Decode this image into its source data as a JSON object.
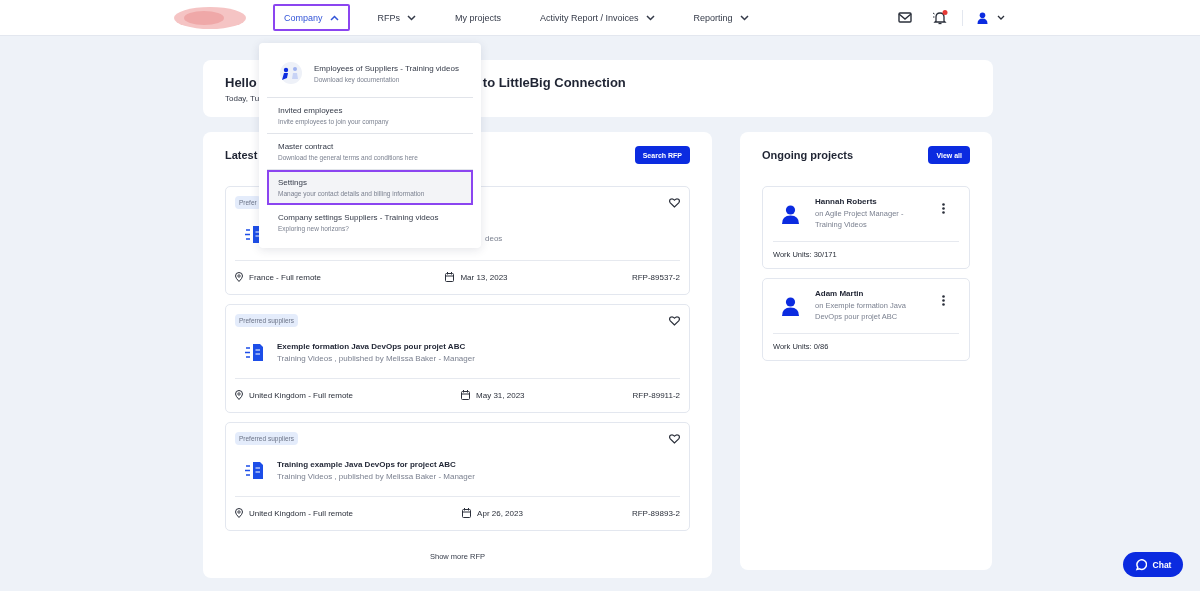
{
  "nav": {
    "items": [
      {
        "label": "Company",
        "has_caret": true,
        "expanded": true,
        "selected": true
      },
      {
        "label": "RFPs",
        "has_caret": true,
        "expanded": false,
        "selected": false
      },
      {
        "label": "My projects",
        "has_caret": false,
        "selected": false
      },
      {
        "label": "Activity Report / Invoices",
        "has_caret": true,
        "expanded": false,
        "selected": false
      },
      {
        "label": "Reporting",
        "has_caret": true,
        "expanded": false,
        "selected": false
      }
    ],
    "notifications_unread": true
  },
  "dropdown": {
    "items": [
      {
        "title": "Employees of Suppliers - Training videos",
        "subtitle": "Download key documentation",
        "has_icon": true,
        "selected": false
      },
      {
        "title": "Invited employees",
        "subtitle": "Invite employees to join your company",
        "has_icon": false,
        "selected": false
      },
      {
        "title": "Master contract",
        "subtitle": "Download the general terms and conditions here",
        "has_icon": false,
        "selected": false
      },
      {
        "title": "Settings",
        "subtitle": "Manage your contact details and billing information",
        "has_icon": false,
        "selected": true
      },
      {
        "title": "Company settings Suppliers - Training videos",
        "subtitle": "Exploring new horizons?",
        "has_icon": false,
        "selected": false
      }
    ]
  },
  "welcome": {
    "greeting_start": "Hello",
    "greeting_end": "to LittleBig Connection",
    "date": "Today, Tu"
  },
  "rfps": {
    "title": "Latest",
    "button": "Search RFP",
    "show_more": "Show more RFP",
    "items": [
      {
        "badge": "Prefer",
        "subtitle": "deos",
        "covered": true,
        "location": "France - Full remote",
        "date": "Mar 13, 2023",
        "id": "RFP-89537-2"
      },
      {
        "badge": "Preferred suppliers",
        "title": "Exemple formation Java DevOps pour projet ABC",
        "subtitle": "Training Videos , published by Melissa Baker - Manager",
        "covered": false,
        "location": "United Kingdom - Full remote",
        "date": "May 31, 2023",
        "id": "RFP-89911-2"
      },
      {
        "badge": "Preferred suppliers",
        "title": "Training example Java DevOps for project ABC",
        "subtitle": "Training Videos , published by Melissa Baker - Manager",
        "covered": false,
        "location": "United Kingdom - Full remote",
        "date": "Apr 26, 2023",
        "id": "RFP-89893-2"
      }
    ]
  },
  "projects": {
    "title": "Ongoing projects",
    "button": "View all",
    "items": [
      {
        "name": "Hannah Roberts",
        "role": "on Agile Project Manager - Training Videos",
        "work_units": "Work Units: 30/171"
      },
      {
        "name": "Adam Martin",
        "role": "on Exemple formation Java DevOps pour projet ABC",
        "work_units": "Work Units: 0/86"
      }
    ]
  },
  "chat": {
    "label": "Chat"
  }
}
